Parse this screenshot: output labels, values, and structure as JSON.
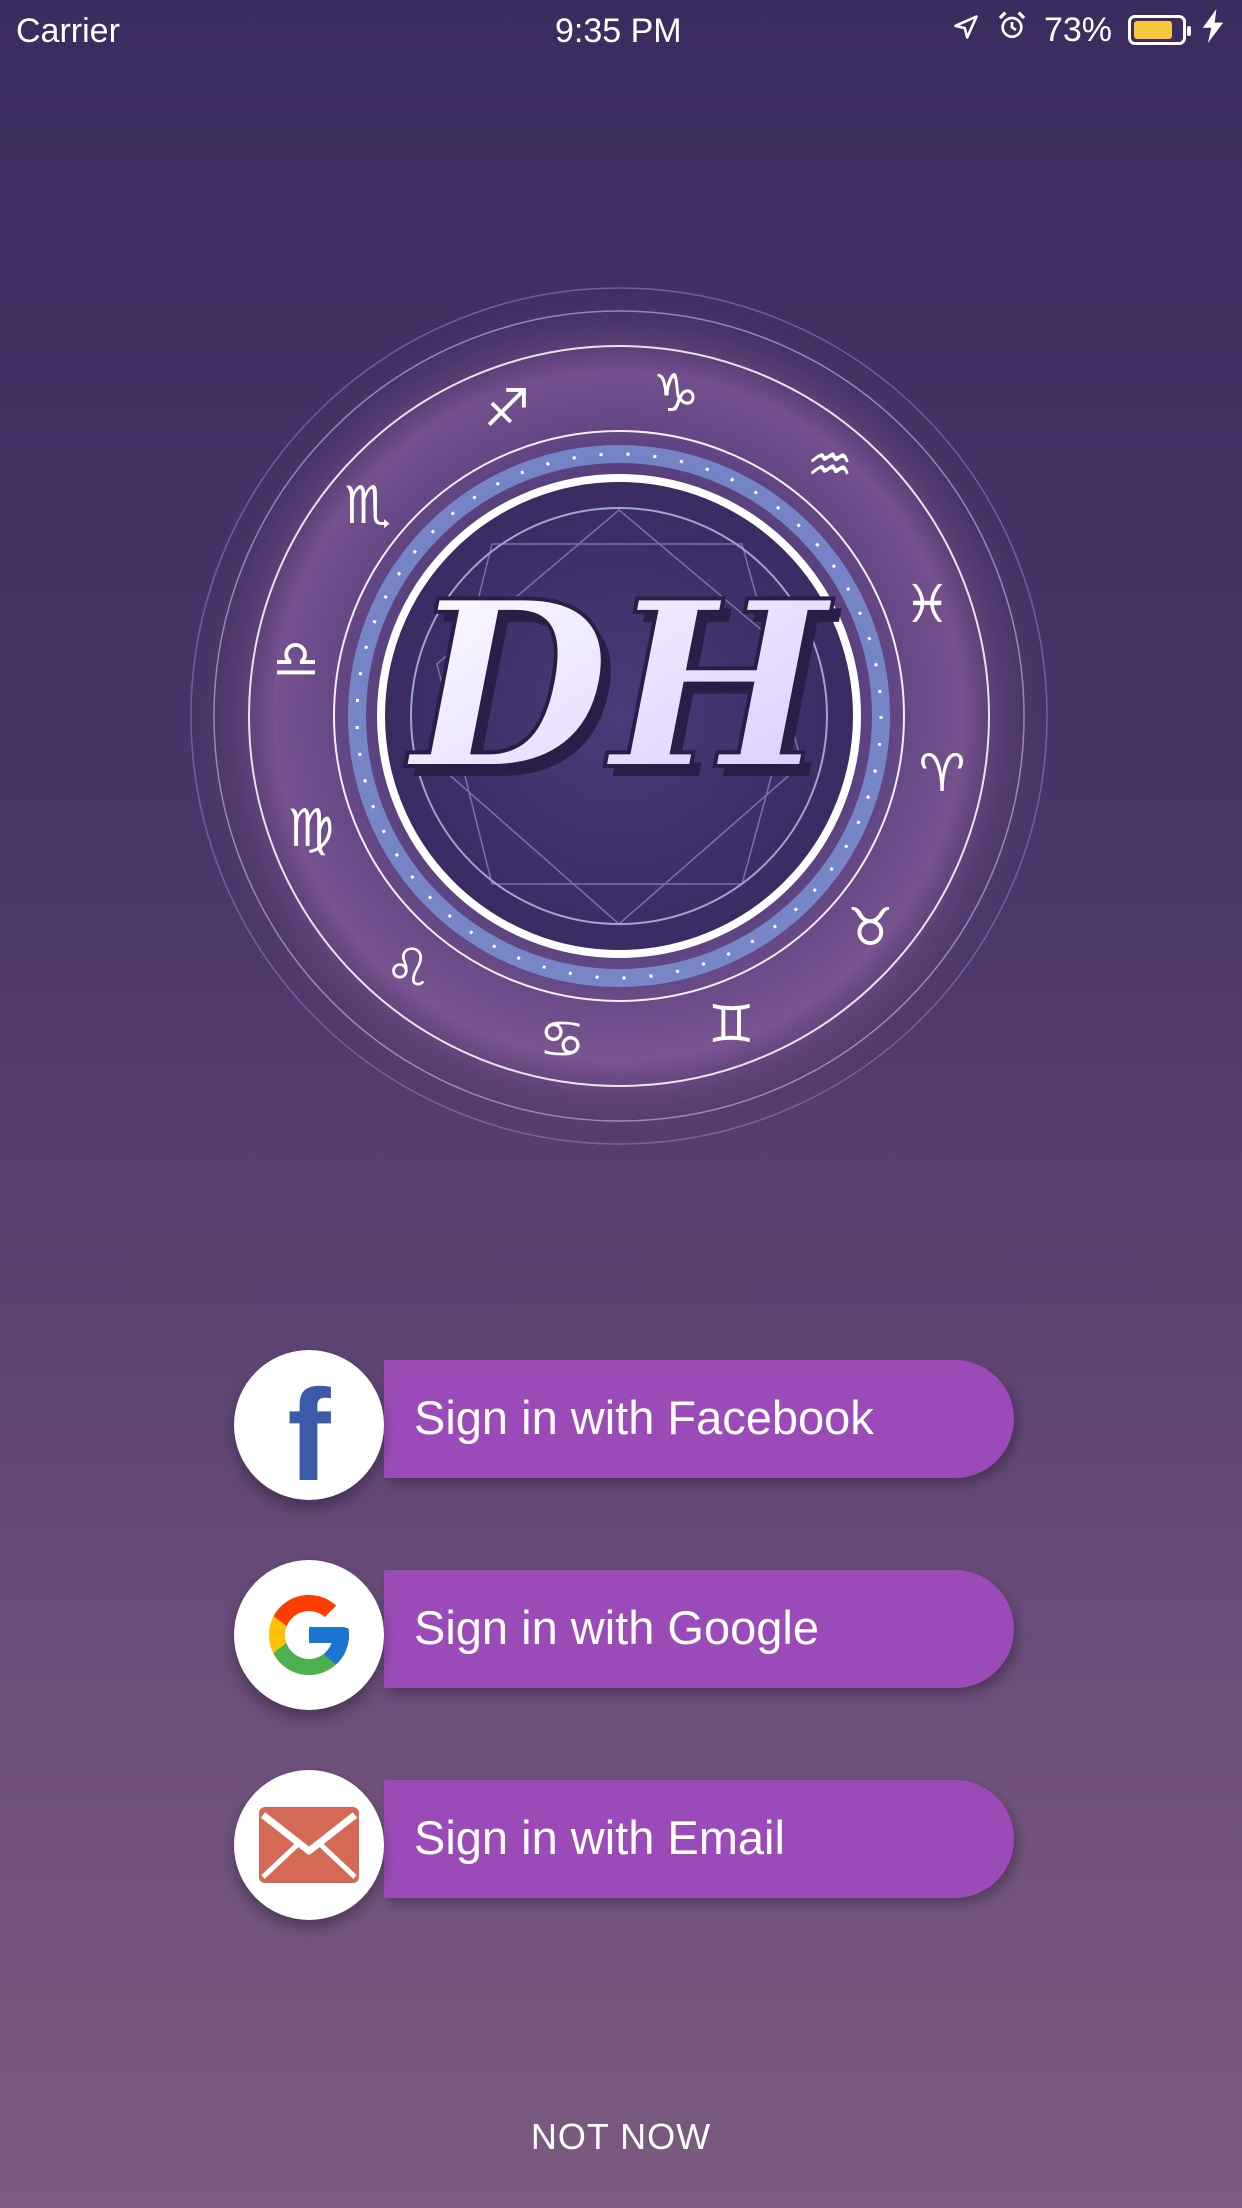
{
  "status_bar": {
    "carrier": "Carrier",
    "time": "9:35 PM",
    "battery_percent": "73%",
    "battery_level": 0.73,
    "icons": [
      "location-arrow-icon",
      "alarm-clock-icon",
      "battery-icon",
      "charging-bolt-icon"
    ]
  },
  "logo": {
    "monogram": "DH",
    "zodiac_symbols": [
      "♑",
      "♒",
      "♓",
      "♈",
      "♉",
      "♊",
      "♋",
      "♌",
      "♍",
      "♎",
      "♏",
      "♐"
    ],
    "accent_colors": [
      "#9b4bb8",
      "#c9b8ff",
      "#ffffff"
    ]
  },
  "auth": {
    "facebook_label": "Sign in with Facebook",
    "google_label": "Sign in with Google",
    "email_label": "Sign in with Email",
    "facebook_icon_glyph": "f"
  },
  "footer": {
    "not_now": "NOT NOW"
  },
  "colors": {
    "button": "#9b4bb8",
    "facebook": "#3b5aa8",
    "email": "#d46a55",
    "battery": "#f6c93d"
  }
}
